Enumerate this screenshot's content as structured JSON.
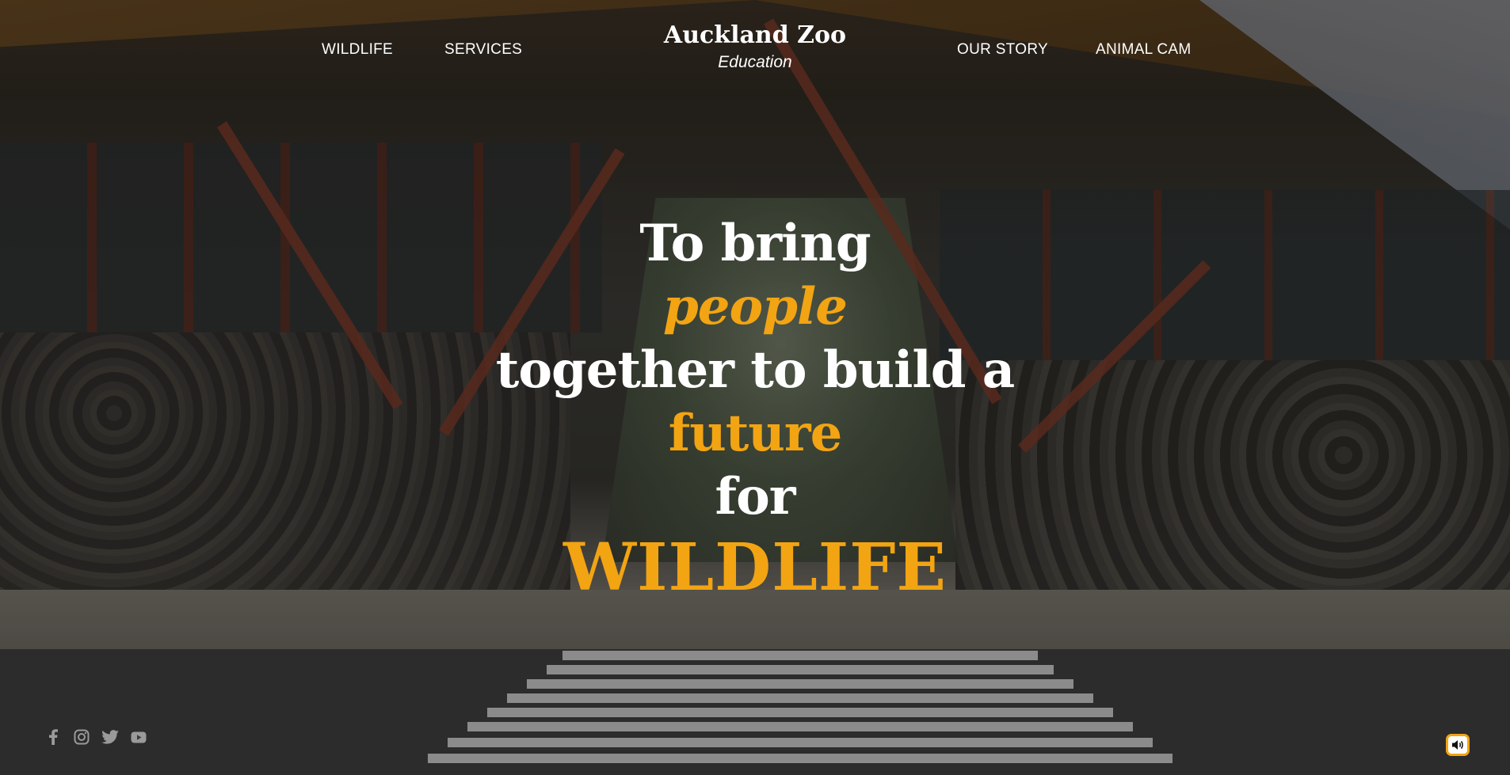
{
  "header": {
    "brand_title": "Auckland Zoo",
    "brand_subtitle": "Education",
    "nav_left": [
      "WILDLIFE",
      "SERVICES"
    ],
    "nav_right": [
      "OUR STORY",
      "ANIMAL CAM"
    ]
  },
  "hero": {
    "lines": [
      "To bring",
      "people",
      "together to build a",
      "future",
      "for",
      "WILDLIFE"
    ]
  },
  "social": {
    "icons": [
      "facebook-icon",
      "instagram-icon",
      "twitter-icon",
      "youtube-icon"
    ]
  },
  "controls": {
    "sound_icon": "speaker-icon"
  },
  "colors": {
    "accent": "#f2a413",
    "text": "#ffffff",
    "social_icon": "#9a9a9a"
  }
}
